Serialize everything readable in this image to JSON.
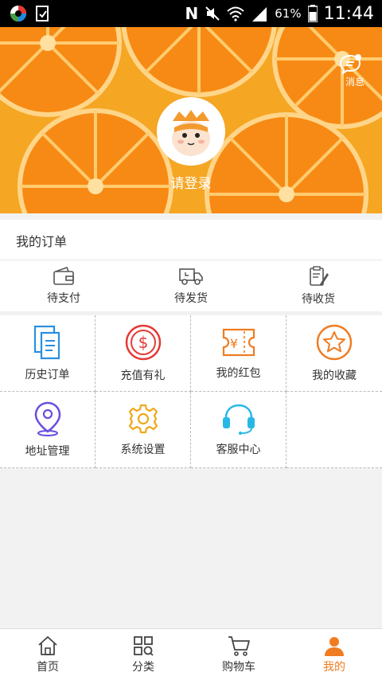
{
  "status_bar": {
    "battery": "61%",
    "time": "11:44"
  },
  "header": {
    "message_label": "消息",
    "login_label": "请登录"
  },
  "orders": {
    "title": "我的订单",
    "items": [
      {
        "label": "待支付",
        "icon": "wallet-icon"
      },
      {
        "label": "待发货",
        "icon": "truck-icon"
      },
      {
        "label": "待收货",
        "icon": "clipboard-icon"
      }
    ]
  },
  "services": {
    "items": [
      {
        "label": "历史订单",
        "icon": "document-icon",
        "color": "#2a8fe0"
      },
      {
        "label": "充值有礼",
        "icon": "dollar-icon",
        "color": "#e53935"
      },
      {
        "label": "我的红包",
        "icon": "coupon-icon",
        "color": "#f07c21"
      },
      {
        "label": "我的收藏",
        "icon": "star-icon",
        "color": "#f07c21"
      },
      {
        "label": "地址管理",
        "icon": "location-icon",
        "color": "#6a4de0"
      },
      {
        "label": "系统设置",
        "icon": "gear-icon",
        "color": "#f0a81c"
      },
      {
        "label": "客服中心",
        "icon": "headset-icon",
        "color": "#28b8e8"
      }
    ]
  },
  "tabbar": {
    "items": [
      {
        "label": "首页",
        "icon": "home-icon"
      },
      {
        "label": "分类",
        "icon": "category-icon"
      },
      {
        "label": "购物车",
        "icon": "cart-icon"
      },
      {
        "label": "我的",
        "icon": "user-icon"
      }
    ],
    "active_color": "#f07c21"
  }
}
